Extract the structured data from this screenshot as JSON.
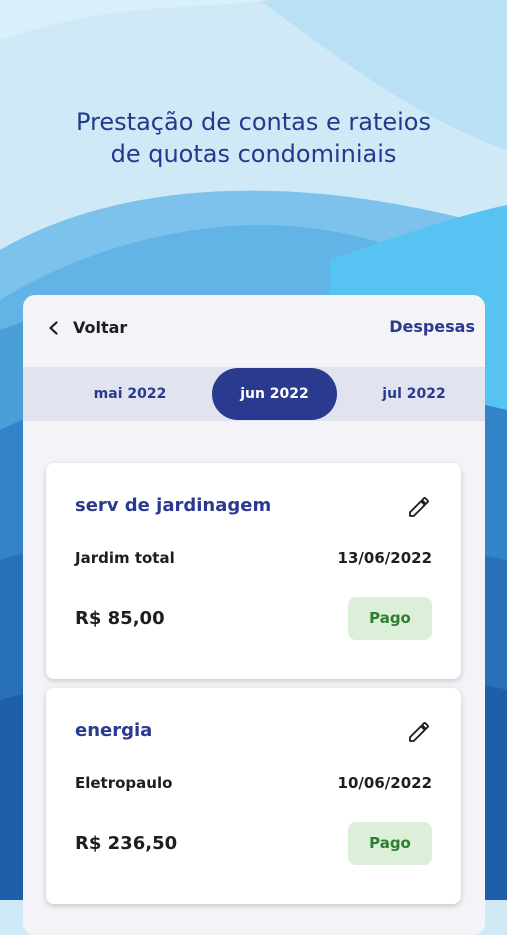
{
  "headline": {
    "line1": "Prestação de contas e rateios",
    "line2": "de quotas condominiais"
  },
  "topbar": {
    "back_label": "Voltar",
    "right_label": "Despesas"
  },
  "months": [
    {
      "label": "mai 2022",
      "selected": false
    },
    {
      "label": "jun 2022",
      "selected": true
    },
    {
      "label": "jul 2022",
      "selected": false
    }
  ],
  "expenses": [
    {
      "title": "serv de jardinagem",
      "description": "Jardim total",
      "date": "13/06/2022",
      "amount": "R$ 85,00",
      "status": "Pago",
      "edit_icon": "pencil-icon"
    },
    {
      "title": "energia",
      "description": "Eletropaulo",
      "date": "10/06/2022",
      "amount": "R$ 236,50",
      "status": "Pago",
      "edit_icon": "pencil-icon"
    }
  ],
  "colors": {
    "brand": "#2a3b8f",
    "paid_bg": "#dbefd9",
    "paid_text": "#2e7d32",
    "background_light": "#cfe9f7",
    "background_dark": "#1d5fa8"
  }
}
